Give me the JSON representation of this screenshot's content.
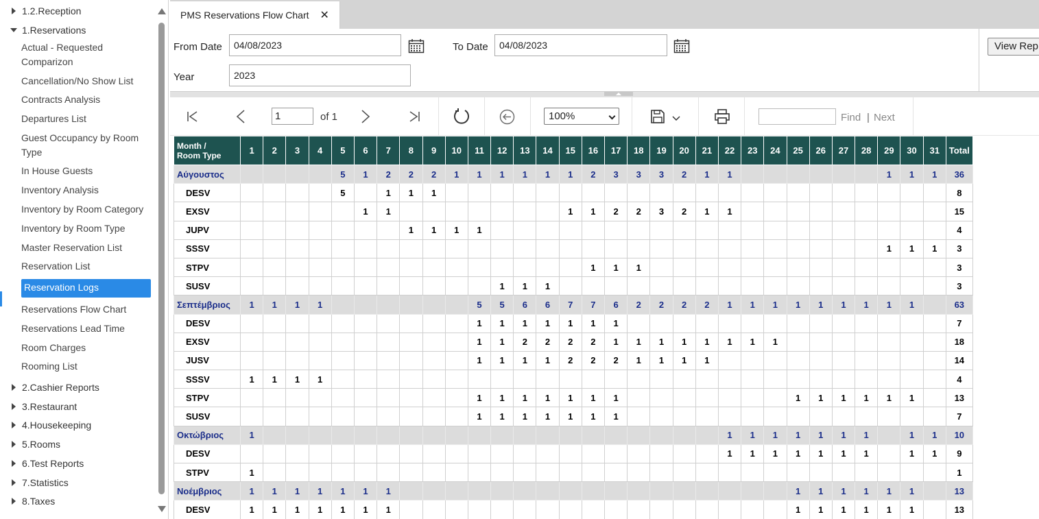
{
  "sidebar": {
    "top_groups": [
      {
        "label": "1.2.Reception",
        "expanded": false
      },
      {
        "label": "1.Reservations",
        "expanded": true
      }
    ],
    "items": [
      {
        "label": "Actual - Requested Comparizon",
        "selected": false
      },
      {
        "label": "Cancellation/No Show List",
        "selected": false
      },
      {
        "label": "Contracts Analysis",
        "selected": false
      },
      {
        "label": "Departures List",
        "selected": false
      },
      {
        "label": "Guest Occupancy by Room Type",
        "selected": false
      },
      {
        "label": "In House Guests",
        "selected": false
      },
      {
        "label": "Inventory Analysis",
        "selected": false
      },
      {
        "label": "Inventory by Room Category",
        "selected": false
      },
      {
        "label": "Inventory by Room Type",
        "selected": false
      },
      {
        "label": "Master Reservation List",
        "selected": false
      },
      {
        "label": "Reservation List",
        "selected": false
      },
      {
        "label": "Reservation Logs",
        "selected": true
      },
      {
        "label": "Reservations Flow Chart",
        "selected": false
      },
      {
        "label": "Reservations Lead Time",
        "selected": false
      },
      {
        "label": "Room Charges",
        "selected": false
      },
      {
        "label": "Rooming List",
        "selected": false
      }
    ],
    "bottom_groups": [
      {
        "label": "2.Cashier Reports"
      },
      {
        "label": "3.Restaurant"
      },
      {
        "label": "4.Housekeeping"
      },
      {
        "label": "5.Rooms"
      },
      {
        "label": "6.Test Reports"
      },
      {
        "label": "7.Statistics"
      },
      {
        "label": "8.Taxes"
      }
    ],
    "accent_color": "#2a8ae6"
  },
  "tab": {
    "title": "PMS Reservations Flow Chart",
    "close_icon": "close-icon"
  },
  "params": {
    "from_date_label": "From Date",
    "from_date_value": "04/08/2023",
    "to_date_label": "To Date",
    "to_date_value": "04/08/2023",
    "year_label": "Year",
    "year_value": "2023",
    "view_report_label": "View Rep"
  },
  "toolbar": {
    "page_value": "1",
    "of_label": "of 1",
    "zoom_value": "100%",
    "find_label": "Find",
    "separator": "|",
    "next_label": "Next"
  },
  "report": {
    "header_color": "#1e5350",
    "first_header": [
      "Month /",
      "Room Type"
    ],
    "days": [
      "1",
      "2",
      "3",
      "4",
      "5",
      "6",
      "7",
      "8",
      "9",
      "10",
      "11",
      "12",
      "13",
      "14",
      "15",
      "16",
      "17",
      "18",
      "19",
      "20",
      "21",
      "22",
      "23",
      "24",
      "25",
      "26",
      "27",
      "28",
      "29",
      "30",
      "31"
    ],
    "total_label": "Total",
    "rows": [
      {
        "kind": "month",
        "name": "Αύγουστος",
        "cells": [
          "",
          "",
          "",
          "",
          "5",
          "1",
          "2",
          "2",
          "2",
          "1",
          "1",
          "1",
          "1",
          "1",
          "1",
          "2",
          "3",
          "3",
          "3",
          "2",
          "1",
          "1",
          "",
          "",
          "",
          "",
          "",
          "",
          "1",
          "1",
          "1"
        ],
        "total": "36"
      },
      {
        "kind": "room",
        "name": "DESV",
        "cells": [
          "",
          "",
          "",
          "",
          "5",
          "",
          "1",
          "1",
          "1",
          "",
          "",
          "",
          "",
          "",
          "",
          "",
          "",
          "",
          "",
          "",
          "",
          "",
          "",
          "",
          "",
          "",
          "",
          "",
          "",
          "",
          ""
        ],
        "total": "8"
      },
      {
        "kind": "room",
        "name": "EXSV",
        "cells": [
          "",
          "",
          "",
          "",
          "",
          "1",
          "1",
          "",
          "",
          "",
          "",
          "",
          "",
          "",
          "1",
          "1",
          "2",
          "2",
          "3",
          "2",
          "1",
          "1",
          "",
          "",
          "",
          "",
          "",
          "",
          "",
          "",
          ""
        ],
        "total": "15"
      },
      {
        "kind": "room",
        "name": "JUPV",
        "cells": [
          "",
          "",
          "",
          "",
          "",
          "",
          "",
          "1",
          "1",
          "1",
          "1",
          "",
          "",
          "",
          "",
          "",
          "",
          "",
          "",
          "",
          "",
          "",
          "",
          "",
          "",
          "",
          "",
          "",
          "",
          "",
          ""
        ],
        "total": "4"
      },
      {
        "kind": "room",
        "name": "SSSV",
        "cells": [
          "",
          "",
          "",
          "",
          "",
          "",
          "",
          "",
          "",
          "",
          "",
          "",
          "",
          "",
          "",
          "",
          "",
          "",
          "",
          "",
          "",
          "",
          "",
          "",
          "",
          "",
          "",
          "",
          "1",
          "1",
          "1"
        ],
        "total": "3"
      },
      {
        "kind": "room",
        "name": "STPV",
        "cells": [
          "",
          "",
          "",
          "",
          "",
          "",
          "",
          "",
          "",
          "",
          "",
          "",
          "",
          "",
          "",
          "1",
          "1",
          "1",
          "",
          "",
          "",
          "",
          "",
          "",
          "",
          "",
          "",
          "",
          "",
          "",
          ""
        ],
        "total": "3"
      },
      {
        "kind": "room",
        "name": "SUSV",
        "cells": [
          "",
          "",
          "",
          "",
          "",
          "",
          "",
          "",
          "",
          "",
          "",
          "1",
          "1",
          "1",
          "",
          "",
          "",
          "",
          "",
          "",
          "",
          "",
          "",
          "",
          "",
          "",
          "",
          "",
          "",
          "",
          ""
        ],
        "total": "3"
      },
      {
        "kind": "month",
        "name": "Σεπτέμβριος",
        "cells": [
          "1",
          "1",
          "1",
          "1",
          "",
          "",
          "",
          "",
          "",
          "",
          "5",
          "5",
          "6",
          "6",
          "7",
          "7",
          "6",
          "2",
          "2",
          "2",
          "2",
          "1",
          "1",
          "1",
          "1",
          "1",
          "1",
          "1",
          "1",
          "1",
          ""
        ],
        "total": "63"
      },
      {
        "kind": "room",
        "name": "DESV",
        "cells": [
          "",
          "",
          "",
          "",
          "",
          "",
          "",
          "",
          "",
          "",
          "1",
          "1",
          "1",
          "1",
          "1",
          "1",
          "1",
          "",
          "",
          "",
          "",
          "",
          "",
          "",
          "",
          "",
          "",
          "",
          "",
          "",
          ""
        ],
        "total": "7"
      },
      {
        "kind": "room",
        "name": "EXSV",
        "cells": [
          "",
          "",
          "",
          "",
          "",
          "",
          "",
          "",
          "",
          "",
          "1",
          "1",
          "2",
          "2",
          "2",
          "2",
          "1",
          "1",
          "1",
          "1",
          "1",
          "1",
          "1",
          "1",
          "",
          "",
          "",
          "",
          "",
          "",
          ""
        ],
        "total": "18"
      },
      {
        "kind": "room",
        "name": "JUSV",
        "cells": [
          "",
          "",
          "",
          "",
          "",
          "",
          "",
          "",
          "",
          "",
          "1",
          "1",
          "1",
          "1",
          "2",
          "2",
          "2",
          "1",
          "1",
          "1",
          "1",
          "",
          "",
          "",
          "",
          "",
          "",
          "",
          "",
          "",
          ""
        ],
        "total": "14"
      },
      {
        "kind": "room",
        "name": "SSSV",
        "cells": [
          "1",
          "1",
          "1",
          "1",
          "",
          "",
          "",
          "",
          "",
          "",
          "",
          "",
          "",
          "",
          "",
          "",
          "",
          "",
          "",
          "",
          "",
          "",
          "",
          "",
          "",
          "",
          "",
          "",
          "",
          "",
          ""
        ],
        "total": "4"
      },
      {
        "kind": "room",
        "name": "STPV",
        "cells": [
          "",
          "",
          "",
          "",
          "",
          "",
          "",
          "",
          "",
          "",
          "1",
          "1",
          "1",
          "1",
          "1",
          "1",
          "1",
          "",
          "",
          "",
          "",
          "",
          "",
          "",
          "1",
          "1",
          "1",
          "1",
          "1",
          "1",
          ""
        ],
        "total": "13"
      },
      {
        "kind": "room",
        "name": "SUSV",
        "cells": [
          "",
          "",
          "",
          "",
          "",
          "",
          "",
          "",
          "",
          "",
          "1",
          "1",
          "1",
          "1",
          "1",
          "1",
          "1",
          "",
          "",
          "",
          "",
          "",
          "",
          "",
          "",
          "",
          "",
          "",
          "",
          "",
          ""
        ],
        "total": "7"
      },
      {
        "kind": "month",
        "name": "Οκτώβριος",
        "cells": [
          "1",
          "",
          "",
          "",
          "",
          "",
          "",
          "",
          "",
          "",
          "",
          "",
          "",
          "",
          "",
          "",
          "",
          "",
          "",
          "",
          "",
          "1",
          "1",
          "1",
          "1",
          "1",
          "1",
          "1",
          "",
          "1",
          "1"
        ],
        "total": "10"
      },
      {
        "kind": "room",
        "name": "DESV",
        "cells": [
          "",
          "",
          "",
          "",
          "",
          "",
          "",
          "",
          "",
          "",
          "",
          "",
          "",
          "",
          "",
          "",
          "",
          "",
          "",
          "",
          "",
          "1",
          "1",
          "1",
          "1",
          "1",
          "1",
          "1",
          "",
          "1",
          "1"
        ],
        "total": "9"
      },
      {
        "kind": "room",
        "name": "STPV",
        "cells": [
          "1",
          "",
          "",
          "",
          "",
          "",
          "",
          "",
          "",
          "",
          "",
          "",
          "",
          "",
          "",
          "",
          "",
          "",
          "",
          "",
          "",
          "",
          "",
          "",
          "",
          "",
          "",
          "",
          "",
          "",
          ""
        ],
        "total": "1"
      },
      {
        "kind": "month",
        "name": "Νοέμβριος",
        "cells": [
          "1",
          "1",
          "1",
          "1",
          "1",
          "1",
          "1",
          "",
          "",
          "",
          "",
          "",
          "",
          "",
          "",
          "",
          "",
          "",
          "",
          "",
          "",
          "",
          "",
          "",
          "1",
          "1",
          "1",
          "1",
          "1",
          "1",
          ""
        ],
        "total": "13"
      },
      {
        "kind": "room",
        "name": "DESV",
        "cells": [
          "1",
          "1",
          "1",
          "1",
          "1",
          "1",
          "1",
          "",
          "",
          "",
          "",
          "",
          "",
          "",
          "",
          "",
          "",
          "",
          "",
          "",
          "",
          "",
          "",
          "",
          "1",
          "1",
          "1",
          "1",
          "1",
          "1",
          ""
        ],
        "total": "13"
      }
    ]
  }
}
